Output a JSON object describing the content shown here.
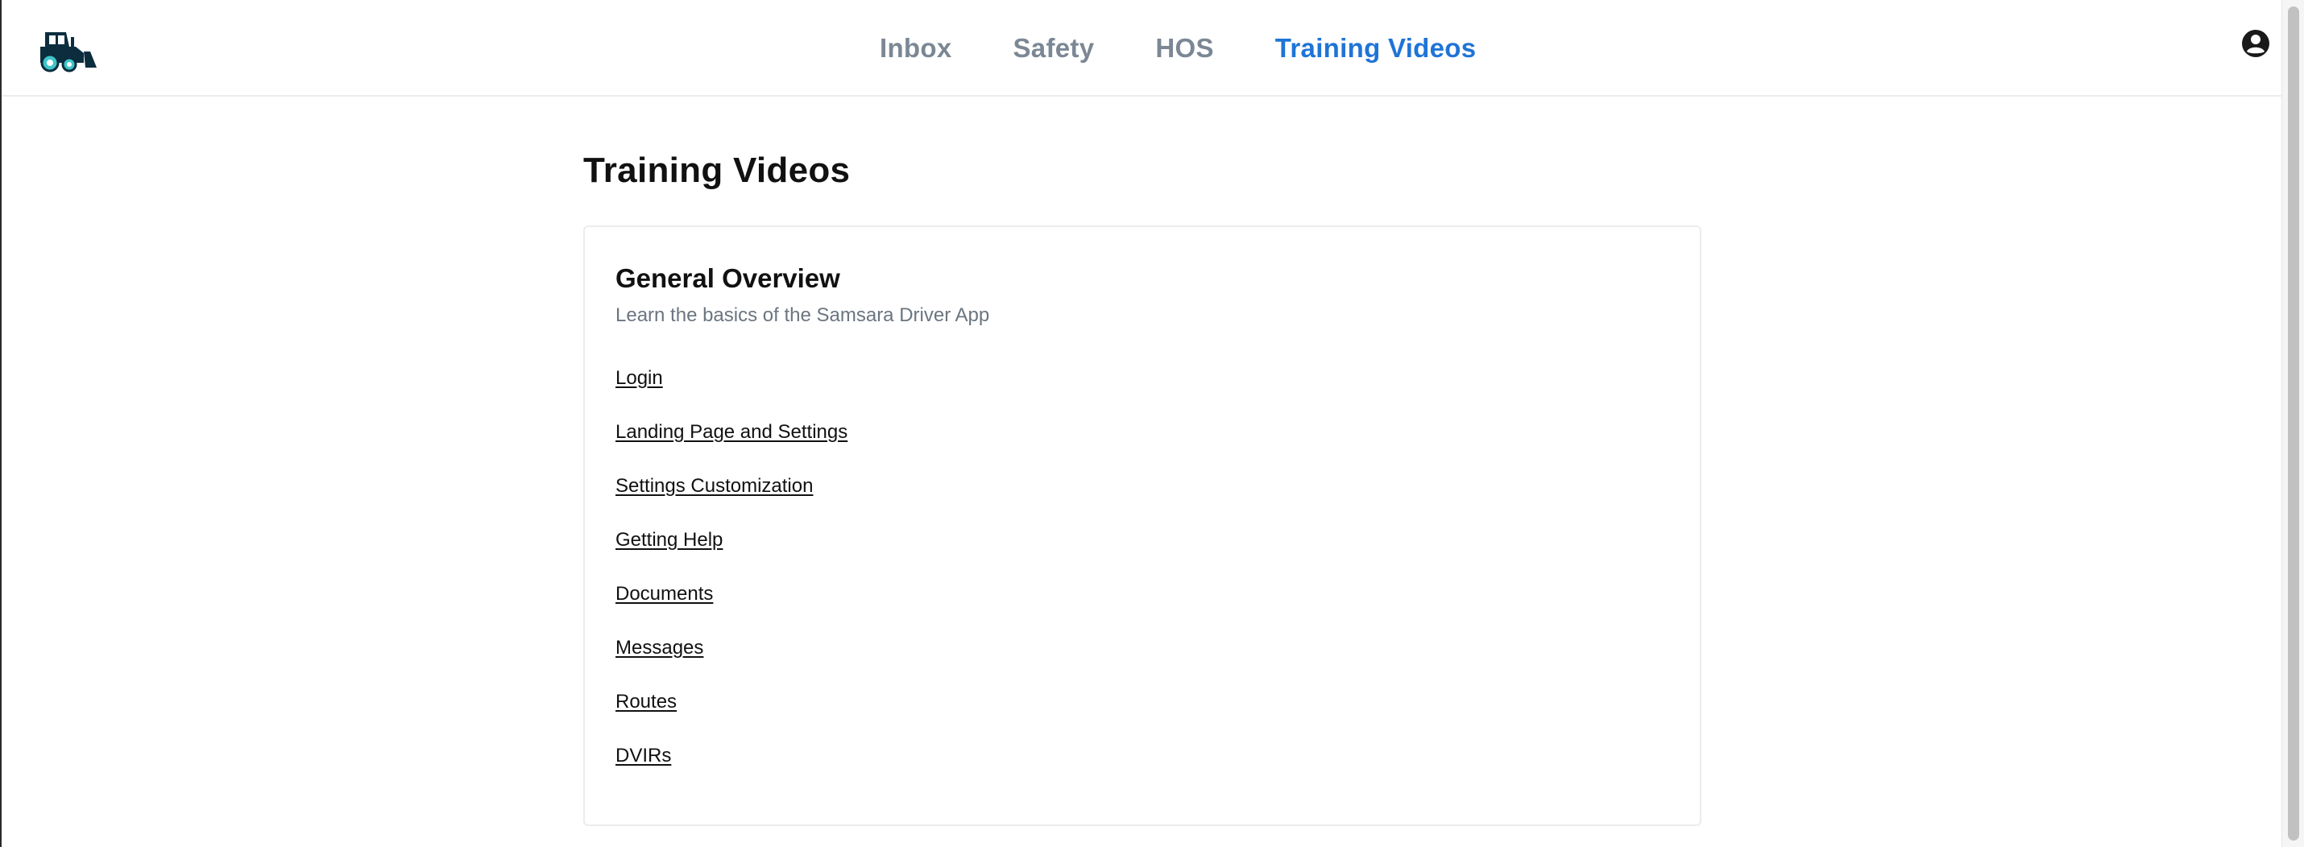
{
  "nav": {
    "tabs": [
      {
        "label": "Inbox",
        "active": false
      },
      {
        "label": "Safety",
        "active": false
      },
      {
        "label": "HOS",
        "active": false
      },
      {
        "label": "Training Videos",
        "active": true
      }
    ],
    "logo_icon": "tractor-icon",
    "account_icon": "account-circle-icon"
  },
  "page": {
    "title": "Training Videos"
  },
  "section": {
    "title": "General Overview",
    "subtitle": "Learn the basics of the Samsara Driver App",
    "videos": [
      "Login",
      "Landing Page and Settings",
      "Settings Customization",
      "Getting Help",
      "Documents",
      "Messages",
      "Routes",
      "DVIRs"
    ]
  },
  "colors": {
    "active_tab": "#1f74d6",
    "inactive_tab": "#7b8794",
    "logo_dark": "#0b2d3e",
    "logo_accent": "#3ec6c9"
  }
}
